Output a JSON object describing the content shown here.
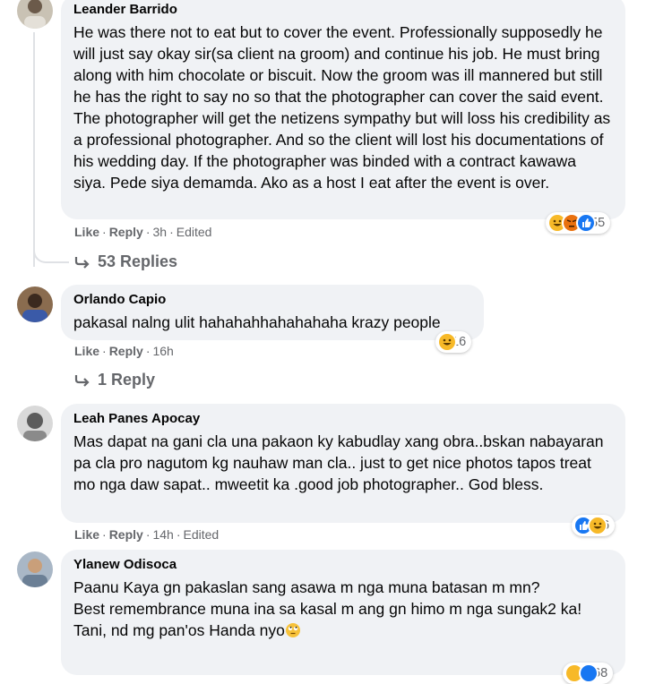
{
  "comments": [
    {
      "author": "Leander Barrido",
      "text": "He was there not to eat but to cover the event. Professionally supposedly he will just say okay sir(sa client na groom) and continue his job. He must bring along with him chocolate or biscuit. Now the groom was ill mannered but still he has the right to say no so that the photographer can cover the said event. The photographer will get the netizens sympathy but will loss his credibility as a professional photographer. And so the client will lost his documentations of his wedding day. If the photographer was binded with a contract kawawa siya. Pede siya demamda. Ako as a host I eat after the event is over.",
      "like": "Like",
      "reply": "Reply",
      "time": "3h",
      "edited": "Edited",
      "reaction_count": "55",
      "reaction_icons": [
        "haha-icon",
        "angry-icon",
        "like-icon"
      ],
      "replies": "53 Replies"
    },
    {
      "author": "Orlando Capio",
      "text": "pakasal nalng ulit hahahahhahahahaha krazy people",
      "like": "Like",
      "reply": "Reply",
      "time": "16h",
      "reaction_count": "16",
      "reaction_icons": [
        "haha-icon"
      ],
      "replies": "1 Reply"
    },
    {
      "author": "Leah Panes Apocay",
      "text": "Mas dapat na gani cla una pakaon ky kabudlay xang obra..bskan nabayaran pa cla pro nagutom kg nauhaw man cla.. just to get nice photos tapos treat mo nga daw sapat.. mweetit ka .good job photographer.. God bless.",
      "like": "Like",
      "reply": "Reply",
      "time": "14h",
      "edited": "Edited",
      "reaction_count": "6",
      "reaction_icons": [
        "like-icon",
        "haha-icon"
      ]
    },
    {
      "author": "Ylanew Odisoca",
      "text_lines": [
        "Paanu Kaya gn pakaslan sang asawa m nga muna batasan m mn?",
        "Best remembrance muna ina sa kasal m ang gn himo m nga sungak2 ka!",
        "Tani, nd mg pan'os Handa nyo"
      ],
      "reaction_count": "68",
      "trailing_emoji": "rolling-eyes-icon"
    }
  ],
  "colors": {
    "bubble": "#f0f2f5",
    "meta_text": "#65676b",
    "like_blue": "#1877f2",
    "haha_yellow": "#f7b928",
    "angry_orange": "#e9710f"
  }
}
